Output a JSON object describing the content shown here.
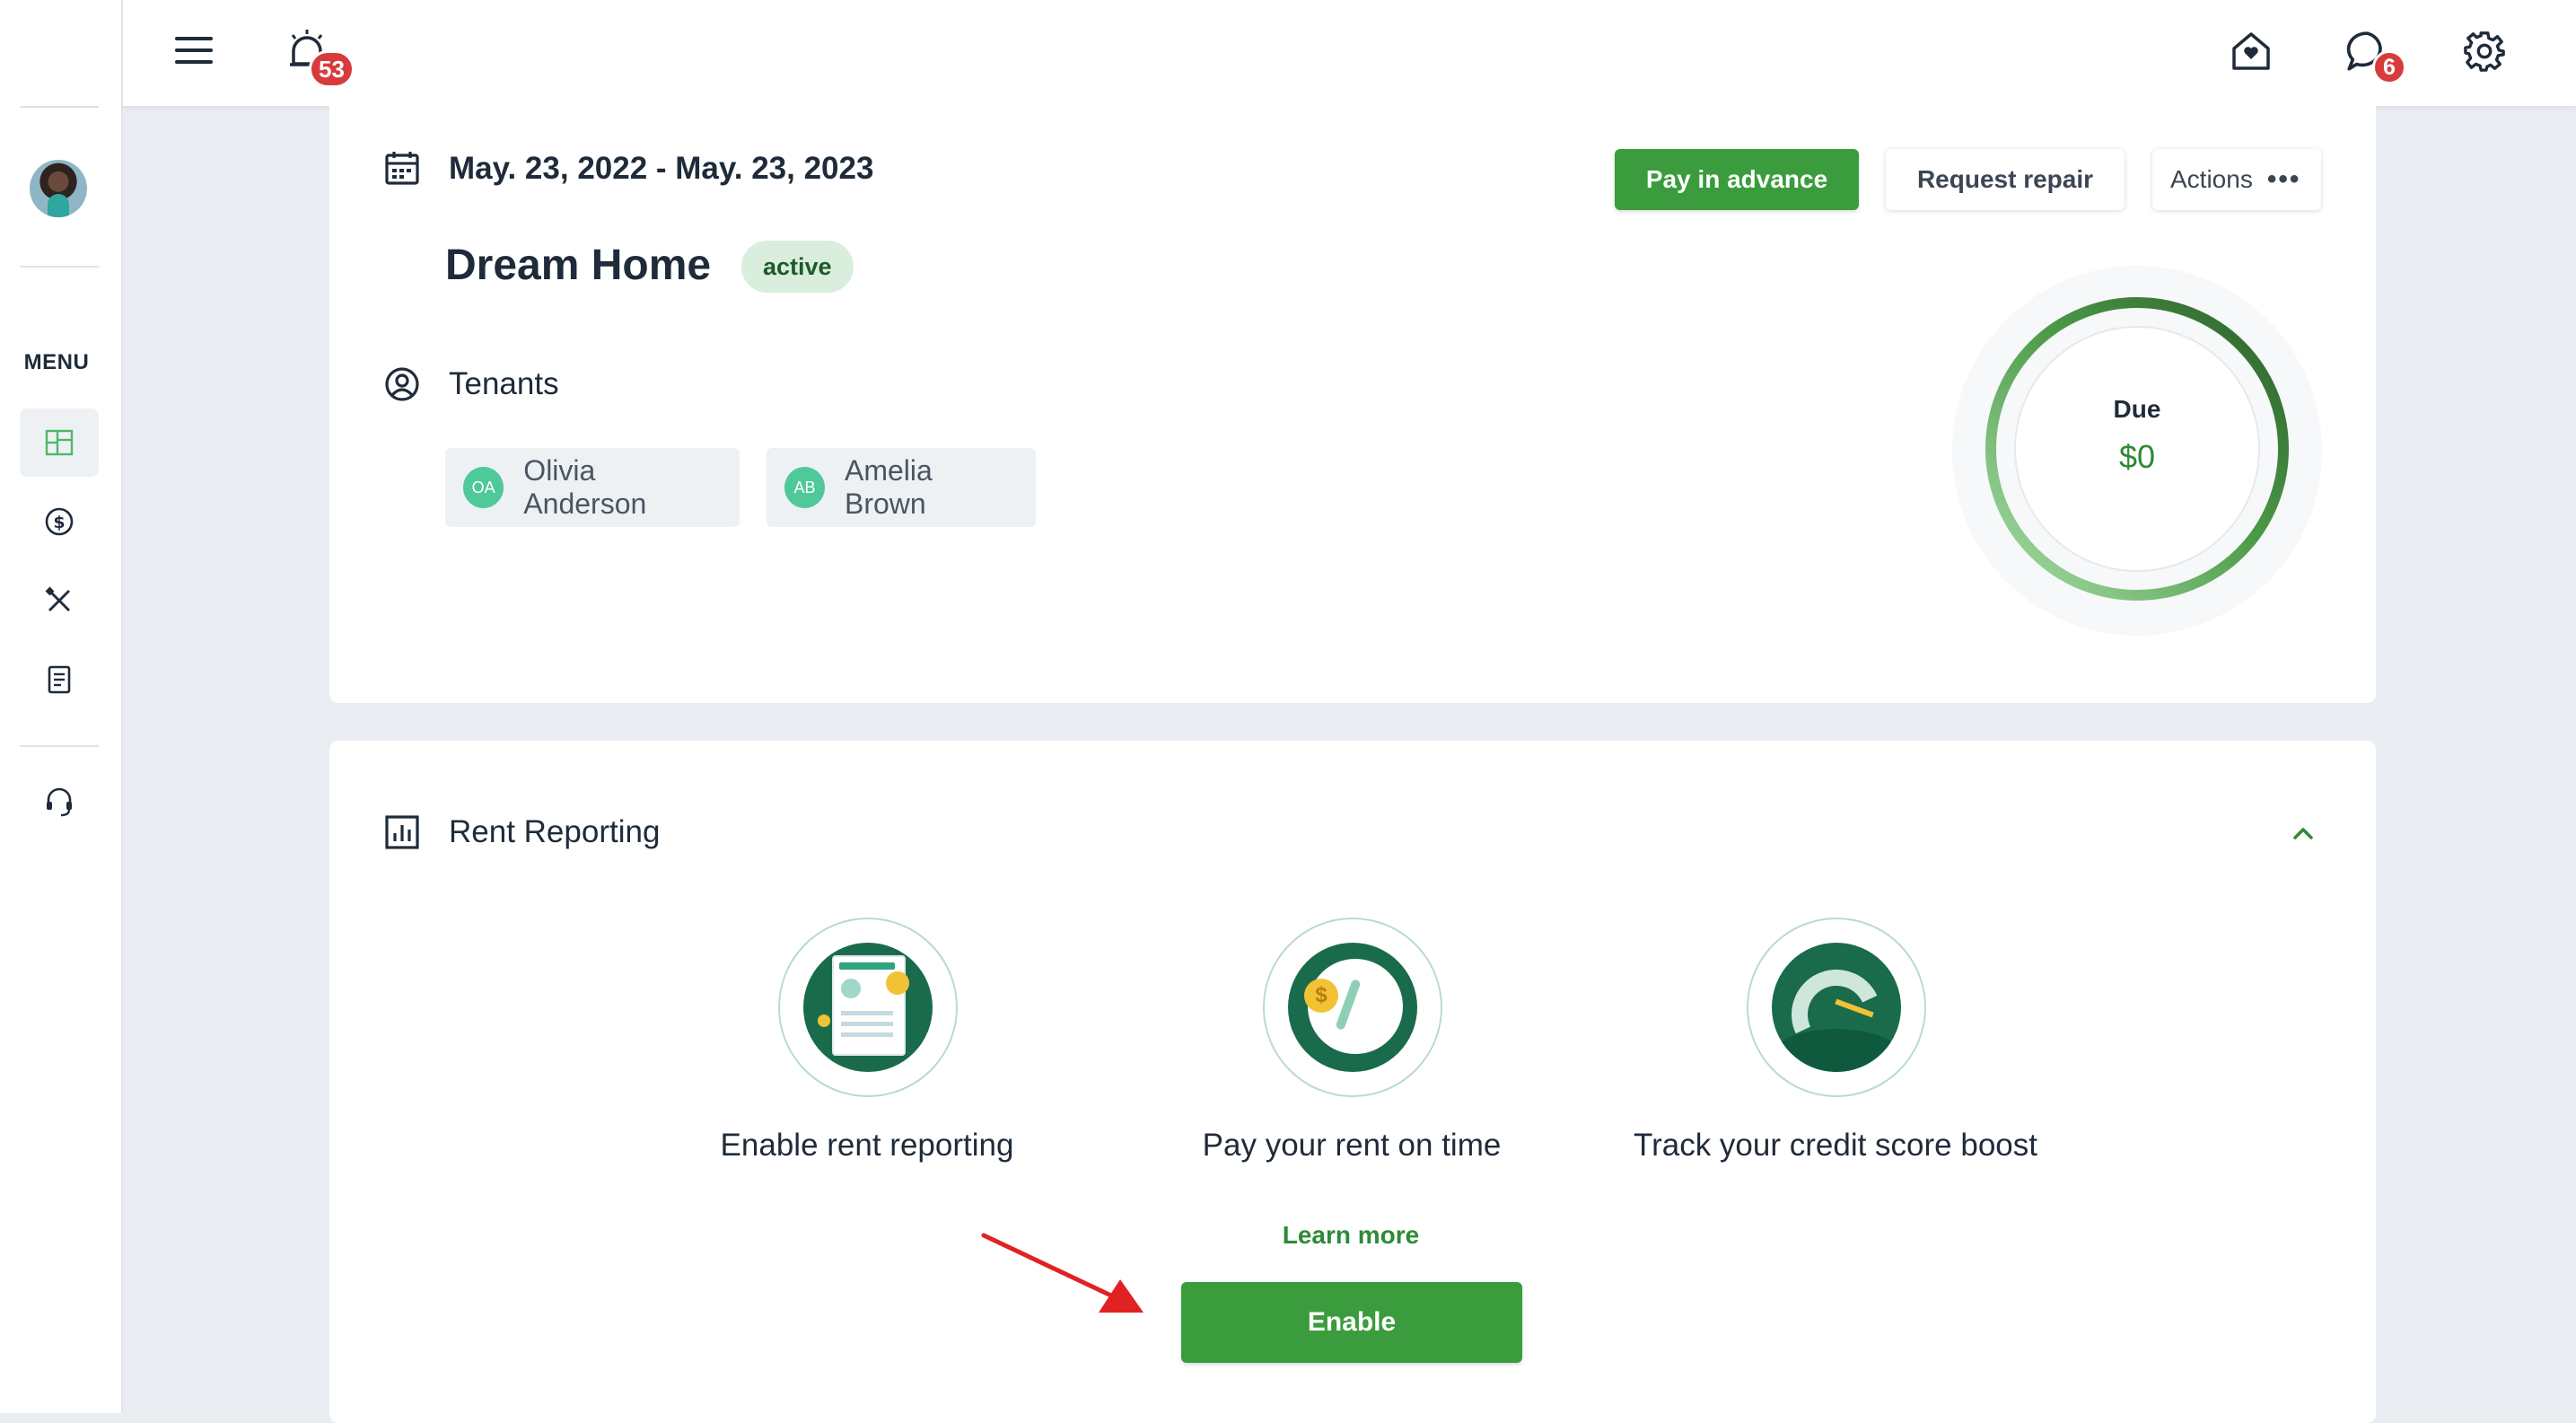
{
  "topbar": {
    "alerts_count": "53",
    "messages_count": "6"
  },
  "sidebar": {
    "menu_label": "MENU"
  },
  "lease": {
    "date_range": "May. 23, 2022 - May. 23, 2023",
    "property_name": "Dream Home",
    "status": "active",
    "tenants_label": "Tenants",
    "tenants": [
      {
        "initials": "OA",
        "name": "Olivia Anderson"
      },
      {
        "initials": "AB",
        "name": "Amelia Brown"
      }
    ],
    "pay_in_advance_label": "Pay in advance",
    "request_repair_label": "Request repair",
    "actions_label": "Actions",
    "due_label": "Due",
    "due_amount": "$0"
  },
  "rent_reporting": {
    "title": "Rent Reporting",
    "features": [
      {
        "title": "Enable rent reporting"
      },
      {
        "title": "Pay your rent on time"
      },
      {
        "title": "Track your credit score boost"
      }
    ],
    "learn_more_label": "Learn more",
    "enable_label": "Enable"
  },
  "colors": {
    "primary_green": "#3a9c3c",
    "badge_red": "#d83b3b",
    "dark_green": "#1a6b4c"
  }
}
